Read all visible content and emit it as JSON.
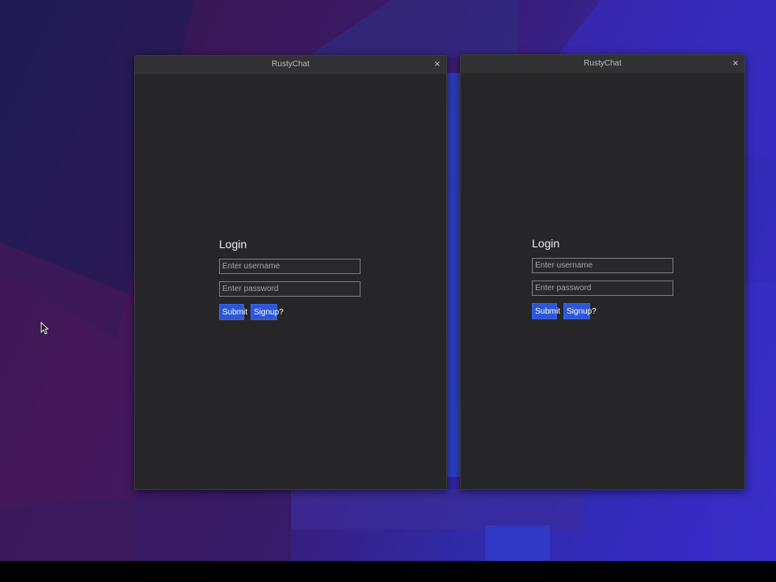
{
  "desktop": {
    "background_colors": [
      "#1d1a4c",
      "#3a1757",
      "#2f2aa8",
      "#3b2ad0"
    ],
    "taskbar_color": "#000000"
  },
  "windows": [
    {
      "title": "RustyChat",
      "close_glyph": "×",
      "close_icon": "close-icon",
      "login": {
        "heading": "Login",
        "username_placeholder": "Enter username",
        "password_placeholder": "Enter password",
        "submit_label": "Submit",
        "signup_label": "Signup?"
      }
    },
    {
      "title": "RustyChat",
      "close_glyph": "×",
      "close_icon": "close-icon",
      "login": {
        "heading": "Login",
        "username_placeholder": "Enter username",
        "password_placeholder": "Enter password",
        "submit_label": "Submit",
        "signup_label": "Signup?"
      }
    }
  ],
  "theme": {
    "window_bg": "#262628",
    "titlebar_bg": "#323234",
    "button_blue": "#2d56d8",
    "text_light": "#f0f0f0"
  },
  "cursor_icon": "arrow-pointer-icon"
}
